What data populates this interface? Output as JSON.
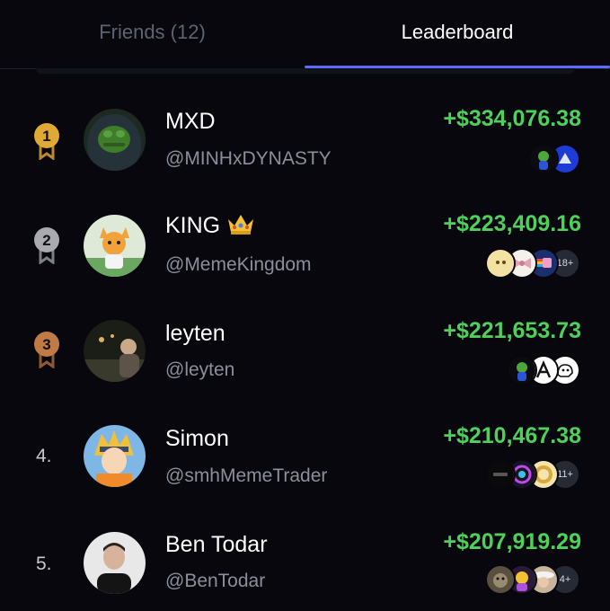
{
  "tabs": {
    "friends_label": "Friends (12)",
    "leaderboard_label": "Leaderboard",
    "active": "leaderboard"
  },
  "colors": {
    "accent": "#5b6cff",
    "profit": "#4fd05a",
    "gold": "#e0a935",
    "silver": "#a8aab0",
    "bronze": "#c07a45"
  },
  "leaderboard": [
    {
      "rank": "1",
      "rank_style": "gold-medal-icon",
      "name": "MXD",
      "handle": "@MINHxDYNASTY",
      "pnl": "+$334,076.38",
      "tokens": [
        "frog-token-icon",
        "blue-shark-token-icon"
      ],
      "more": ""
    },
    {
      "rank": "2",
      "rank_style": "silver-medal-icon",
      "name": "KING",
      "name_emoji": "crown-icon",
      "handle": "@MemeKingdom",
      "pnl": "+$223,409.16",
      "tokens": [
        "yellow-face-token-icon",
        "bow-token-icon",
        "nyan-cat-token-icon"
      ],
      "more": "18+"
    },
    {
      "rank": "3",
      "rank_style": "bronze-medal-icon",
      "name": "leyten",
      "handle": "@leyten",
      "pnl": "+$221,653.73",
      "tokens": [
        "frog-token-icon",
        "letter-a-token-icon",
        "cat-sketch-token-icon"
      ],
      "more": ""
    },
    {
      "rank": "4.",
      "rank_style": "number",
      "name": "Simon",
      "handle": "@smhMemeTrader",
      "pnl": "+$210,467.38",
      "tokens": [
        "dark-text-token-icon",
        "colorful-ring-token-icon",
        "gold-coin-token-icon"
      ],
      "more": "11+"
    },
    {
      "rank": "5.",
      "rank_style": "number",
      "name": "Ben Todar",
      "handle": "@BenTodar",
      "pnl": "+$207,919.29",
      "tokens": [
        "dog-token-icon",
        "emoji-woman-token-icon",
        "cowboy-token-icon"
      ],
      "more": "4+"
    }
  ]
}
